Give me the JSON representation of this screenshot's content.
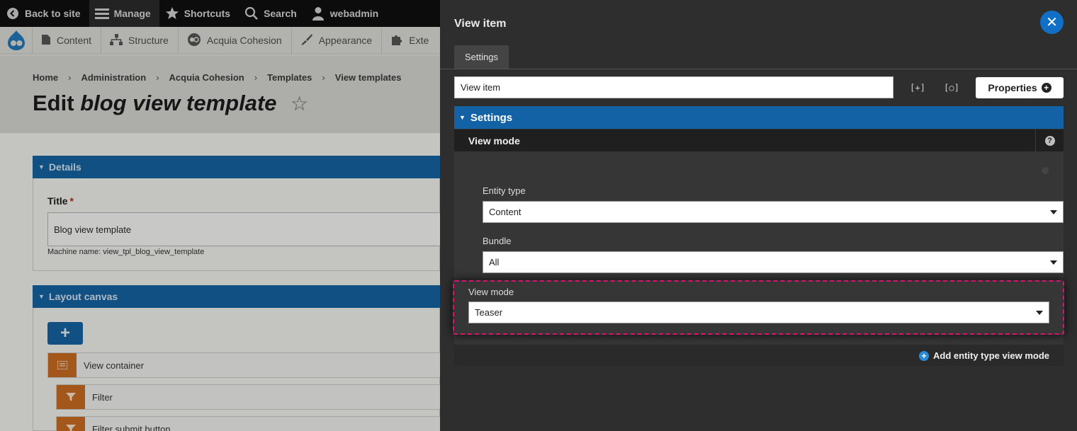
{
  "toolbar": {
    "back": "Back to site",
    "manage": "Manage",
    "shortcuts": "Shortcuts",
    "search": "Search",
    "user": "webadmin"
  },
  "tray": {
    "items": [
      "Content",
      "Structure",
      "Acquia Cohesion",
      "Appearance",
      "Exte"
    ]
  },
  "breadcrumb": [
    "Home",
    "Administration",
    "Acquia Cohesion",
    "Templates",
    "View templates"
  ],
  "page": {
    "title_prefix": "Edit",
    "title_em": "blog view template",
    "details_label": "Details",
    "title_label": "Title",
    "title_required": "*",
    "title_value": "Blog view template",
    "machine_name": "Machine name: view_tpl_blog_view_template",
    "layout_canvas_label": "Layout canvas",
    "add_plus": "+",
    "rows": [
      "View container",
      "Filter",
      "Filter submit button"
    ]
  },
  "panel": {
    "title": "View item",
    "close": "✕",
    "tab": "Settings",
    "item_name": "View item",
    "btn_expand": "[+]",
    "btn_search": "[○]",
    "properties": "Properties",
    "settings_section": "Settings",
    "view_mode_title": "View mode",
    "help": "?",
    "fields": {
      "entity_type_label": "Entity type",
      "entity_type_value": "Content",
      "bundle_label": "Bundle",
      "bundle_value": "All",
      "view_mode_label": "View mode",
      "view_mode_value": "Teaser"
    },
    "add_link": "Add entity type view mode",
    "add_plus": "+"
  },
  "colors": {
    "accent_blue": "#1262a5",
    "close_blue": "#1170c6",
    "highlight_pink": "#d8146e",
    "panel_bg": "#2e2e2e"
  }
}
